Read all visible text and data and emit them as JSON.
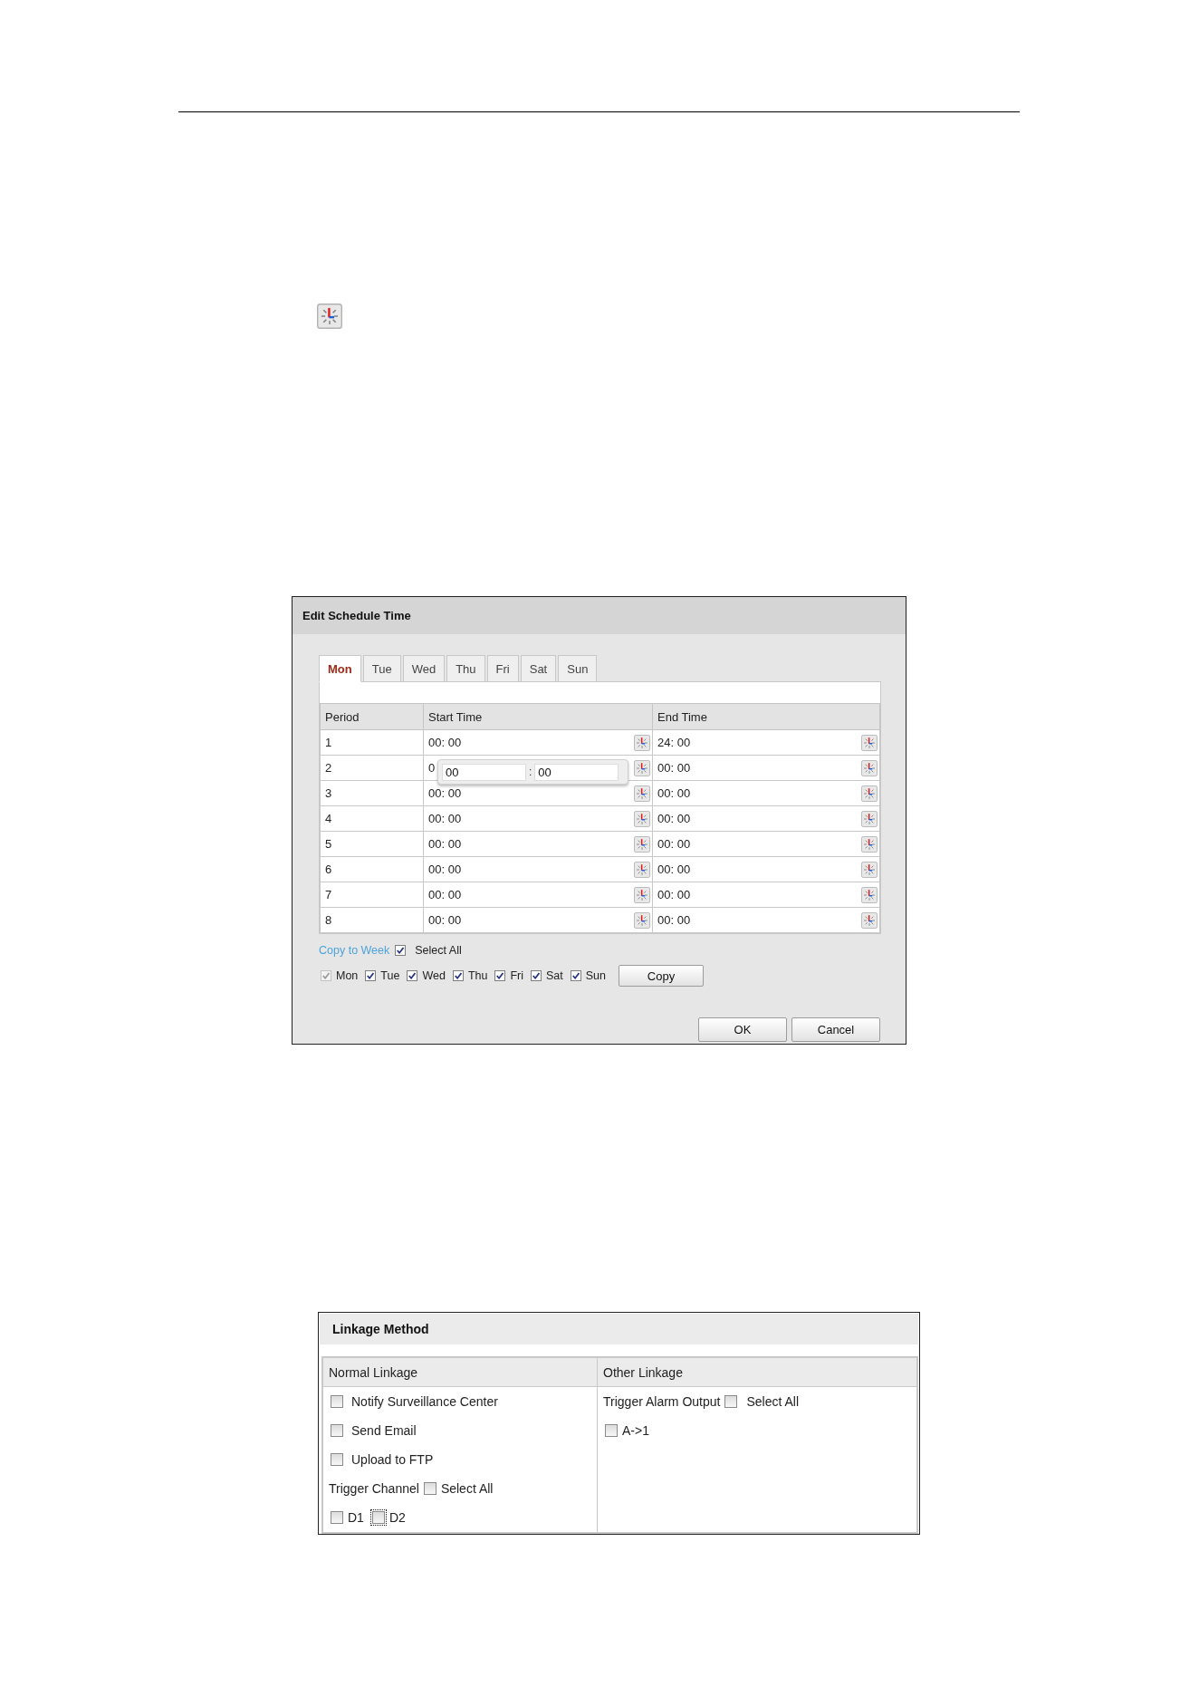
{
  "schedule_dialog": {
    "title": "Edit Schedule Time",
    "tabs": [
      {
        "label": "Mon",
        "selected": true
      },
      {
        "label": "Tue",
        "selected": false
      },
      {
        "label": "Wed",
        "selected": false
      },
      {
        "label": "Thu",
        "selected": false
      },
      {
        "label": "Fri",
        "selected": false
      },
      {
        "label": "Sat",
        "selected": false
      },
      {
        "label": "Sun",
        "selected": false
      }
    ],
    "columns": [
      "Period",
      "Start Time",
      "End Time"
    ],
    "rows": [
      {
        "period": "1",
        "start": "00: 00",
        "end": "24: 00"
      },
      {
        "period": "2",
        "start": "0",
        "end": "00: 00",
        "picker": {
          "hour": "00",
          "separator": ":",
          "minute": "00"
        }
      },
      {
        "period": "3",
        "start": "00: 00",
        "end": "00: 00"
      },
      {
        "period": "4",
        "start": "00: 00",
        "end": "00: 00"
      },
      {
        "period": "5",
        "start": "00: 00",
        "end": "00: 00"
      },
      {
        "period": "6",
        "start": "00: 00",
        "end": "00: 00"
      },
      {
        "period": "7",
        "start": "00: 00",
        "end": "00: 00"
      },
      {
        "period": "8",
        "start": "00: 00",
        "end": "00: 00"
      }
    ],
    "copy_to_week": {
      "link": "Copy to Week",
      "select_all": {
        "label": "Select All",
        "checked": true
      }
    },
    "days": [
      {
        "label": "Mon",
        "checked": true,
        "disabled": true
      },
      {
        "label": "Tue",
        "checked": true,
        "disabled": false
      },
      {
        "label": "Wed",
        "checked": true,
        "disabled": false
      },
      {
        "label": "Thu",
        "checked": true,
        "disabled": false
      },
      {
        "label": "Fri",
        "checked": true,
        "disabled": false
      },
      {
        "label": "Sat",
        "checked": true,
        "disabled": false
      },
      {
        "label": "Sun",
        "checked": true,
        "disabled": false
      }
    ],
    "copy_button": "Copy",
    "buttons": [
      "OK",
      "Cancel"
    ]
  },
  "linkage_method": {
    "title": "Linkage Method",
    "columns": [
      "Normal Linkage",
      "Other Linkage"
    ],
    "normal": {
      "options": [
        {
          "label": "Notify Surveillance Center",
          "checked": false
        },
        {
          "label": "Send Email",
          "checked": false
        },
        {
          "label": "Upload to FTP",
          "checked": false
        }
      ],
      "trigger_channel": {
        "label": "Trigger Channel",
        "select_all": {
          "label": "Select All",
          "checked": false
        }
      },
      "channels": [
        {
          "label": "D1",
          "checked": false,
          "focused": false
        },
        {
          "label": "D2",
          "checked": false,
          "focused": true
        }
      ]
    },
    "other": {
      "trigger_alarm_output": {
        "label": "Trigger Alarm Output",
        "select_all": {
          "label": "Select All",
          "checked": false
        }
      },
      "outputs": [
        {
          "label": "A->1",
          "checked": false
        }
      ]
    }
  }
}
